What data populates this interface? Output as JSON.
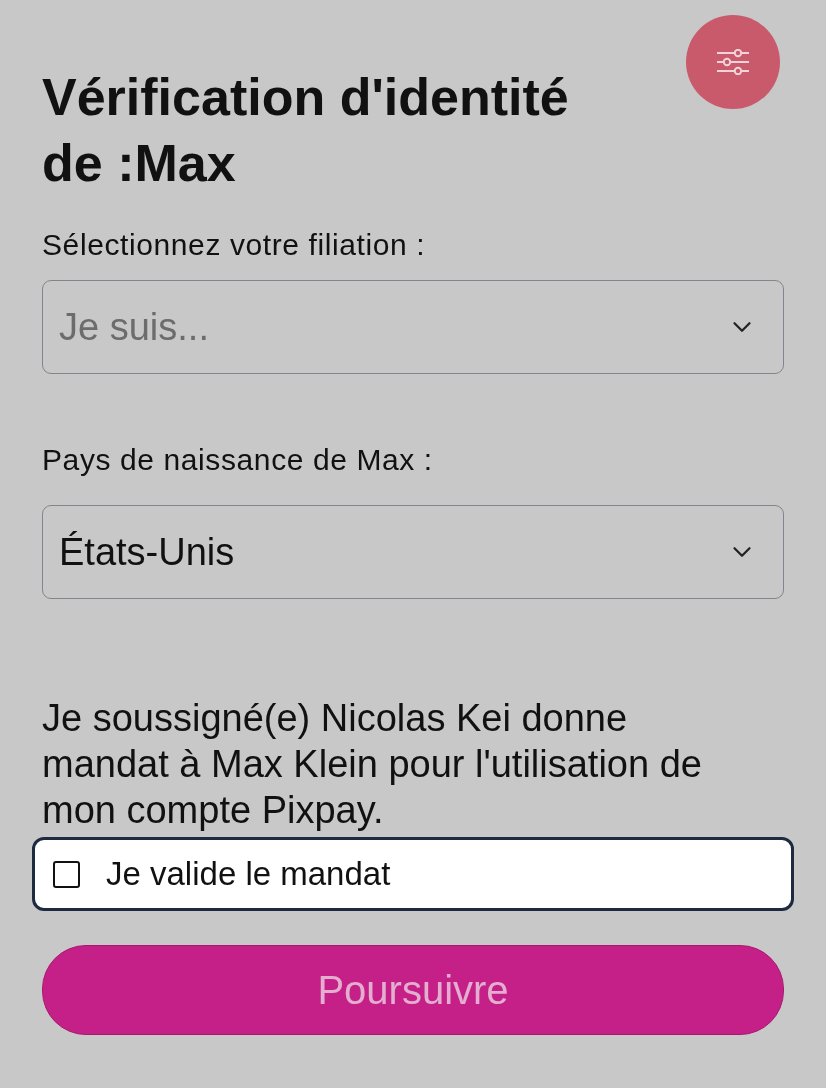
{
  "header": {
    "title": "Vérification d'identité de :Max"
  },
  "fields": [
    {
      "label": "Sélectionnez votre filiation :",
      "placeholder": "Je suis..."
    },
    {
      "label": "Pays de naissance de Max :",
      "value": "États-Unis"
    }
  ],
  "mandate": {
    "text": "Je soussigné(e) Nicolas Kei donne mandat à Max Klein pour l'utilisation de mon compte Pixpay.",
    "checkbox": {
      "label": "Je valide le mandat",
      "checked": false
    }
  },
  "button": {
    "label": "Poursuivre",
    "disabled": true
  }
}
